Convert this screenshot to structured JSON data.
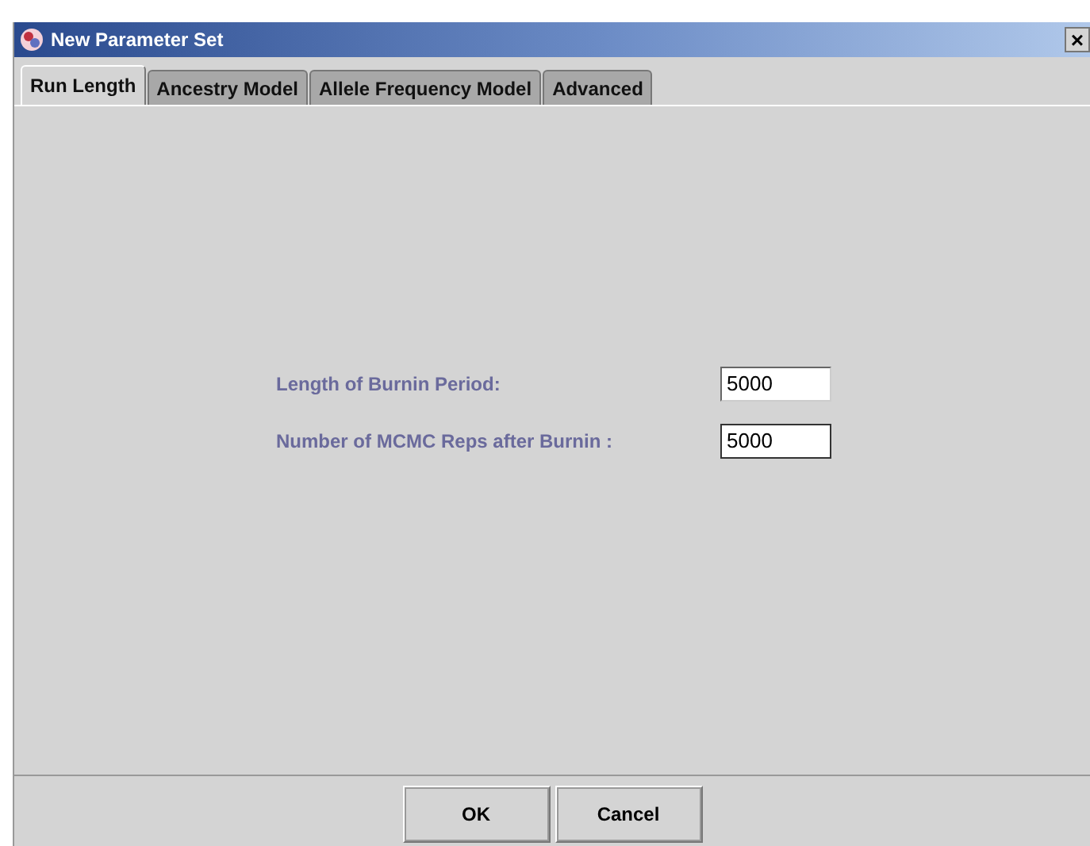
{
  "window": {
    "title": "New Parameter Set",
    "close": "×"
  },
  "tabs": [
    {
      "label": "Run Length",
      "selected": true
    },
    {
      "label": "Ancestry Model",
      "selected": false
    },
    {
      "label": "Allele Frequency Model",
      "selected": false
    },
    {
      "label": "Advanced",
      "selected": false
    }
  ],
  "fields": [
    {
      "label": "Length of Burnin Period:",
      "value": "5000",
      "focused": false
    },
    {
      "label": "Number of MCMC Reps after Burnin :",
      "value": "5000",
      "focused": true
    }
  ],
  "buttons": [
    "OK",
    "Cancel"
  ]
}
